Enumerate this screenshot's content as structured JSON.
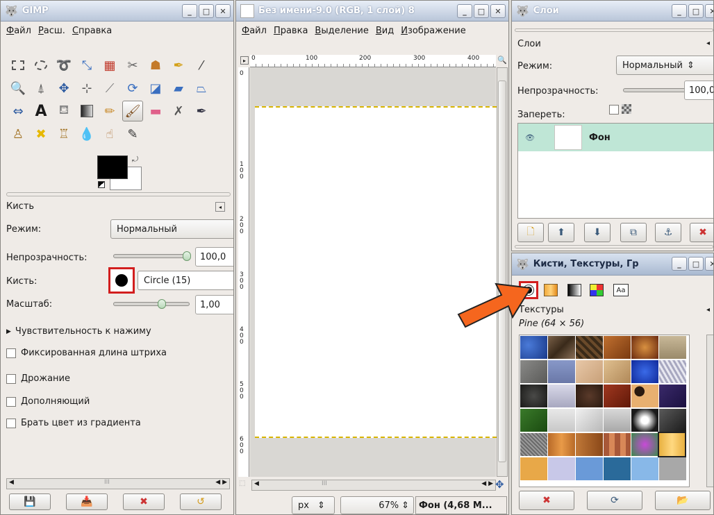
{
  "toolbox": {
    "title": "GIMP",
    "menu": [
      "Файл",
      "Расш.",
      "Справка"
    ],
    "panel_title": "Кисть",
    "mode_label": "Режим:",
    "mode_value": "Нормальный",
    "opacity_label": "Непрозрачность:",
    "opacity_value": "100,0",
    "opacity_level": 1.0,
    "brush_label": "Кисть:",
    "brush_value": "Circle (15)",
    "scale_label": "Масштаб:",
    "scale_value": "1,00",
    "pressure_label": "Чувствительность к нажиму",
    "options": [
      "Фиксированная длина штриха",
      "Дрожание",
      "Дополняющий",
      "Брать цвет из градиента"
    ],
    "scroll_center": "III"
  },
  "image_window": {
    "title": "Без имени-9.0 (RGB, 1 слой) 8",
    "menu": [
      "Файл",
      "Правка",
      "Выделение",
      "Вид",
      "Изображение"
    ],
    "ruler_labels": [
      "0",
      "100",
      "200",
      "300",
      "400"
    ],
    "vruler_labels": [
      "0",
      "1\n0\n0",
      "2\n0\n0",
      "3\n0\n0",
      "4\n0\n0",
      "5\n0\n0",
      "6\n0\n0"
    ],
    "unit": "px",
    "zoom": "67%",
    "status": "Фон (4,68 М...",
    "scroll_center": "III"
  },
  "layers": {
    "title": "Слои",
    "panel_title": "Слои",
    "mode_label": "Режим:",
    "mode_value": "Нормальный",
    "opacity_label": "Непрозрачность:",
    "opacity_value": "100,0",
    "lock_label": "Запереть:",
    "layer_name": "Фон"
  },
  "brushes": {
    "title": "Кисти, Текстуры, Гр",
    "panel_title": "Текстуры",
    "pattern_name": "Pine (64 × 56)",
    "tab_text_icon": "Aa"
  },
  "colors": {
    "accent_red": "#d21e1e",
    "arrow": "#f5661e",
    "layer_selected": "#bfe6d6",
    "fg_color": "#000000",
    "bg_color": "#ffffff"
  }
}
